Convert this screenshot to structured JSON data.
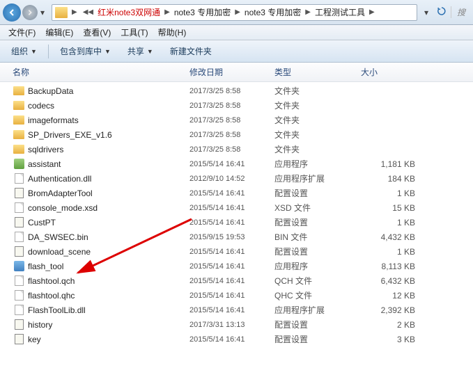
{
  "breadcrumb": {
    "items": [
      "红米note3双网通",
      "note3 专用加密",
      "note3 专用加密",
      "工程测试工具"
    ]
  },
  "search": {
    "placeholder": "搜"
  },
  "menu": {
    "file": "文件(F)",
    "edit": "编辑(E)",
    "view": "查看(V)",
    "tools": "工具(T)",
    "help": "帮助(H)"
  },
  "toolbar": {
    "organize": "组织",
    "include": "包含到库中",
    "share": "共享",
    "newfolder": "新建文件夹"
  },
  "columns": {
    "name": "名称",
    "date": "修改日期",
    "type": "类型",
    "size": "大小"
  },
  "files": [
    {
      "icon": "folder",
      "name": "BackupData",
      "date": "2017/3/25 8:58",
      "type": "文件夹",
      "size": ""
    },
    {
      "icon": "folder",
      "name": "codecs",
      "date": "2017/3/25 8:58",
      "type": "文件夹",
      "size": ""
    },
    {
      "icon": "folder",
      "name": "imageformats",
      "date": "2017/3/25 8:58",
      "type": "文件夹",
      "size": ""
    },
    {
      "icon": "folder",
      "name": "SP_Drivers_EXE_v1.6",
      "date": "2017/3/25 8:58",
      "type": "文件夹",
      "size": ""
    },
    {
      "icon": "folder",
      "name": "sqldrivers",
      "date": "2017/3/25 8:58",
      "type": "文件夹",
      "size": ""
    },
    {
      "icon": "green",
      "name": "assistant",
      "date": "2015/5/14 16:41",
      "type": "应用程序",
      "size": "1,181 KB"
    },
    {
      "icon": "generic",
      "name": "Authentication.dll",
      "date": "2012/9/10 14:52",
      "type": "应用程序扩展",
      "size": "184 KB"
    },
    {
      "icon": "cfg",
      "name": "BromAdapterTool",
      "date": "2015/5/14 16:41",
      "type": "配置设置",
      "size": "1 KB"
    },
    {
      "icon": "generic",
      "name": "console_mode.xsd",
      "date": "2015/5/14 16:41",
      "type": "XSD 文件",
      "size": "15 KB"
    },
    {
      "icon": "cfg",
      "name": "CustPT",
      "date": "2015/5/14 16:41",
      "type": "配置设置",
      "size": "1 KB"
    },
    {
      "icon": "generic",
      "name": "DA_SWSEC.bin",
      "date": "2015/9/15 19:53",
      "type": "BIN 文件",
      "size": "4,432 KB"
    },
    {
      "icon": "cfg",
      "name": "download_scene",
      "date": "2015/5/14 16:41",
      "type": "配置设置",
      "size": "1 KB"
    },
    {
      "icon": "disk",
      "name": "flash_tool",
      "date": "2015/5/14 16:41",
      "type": "应用程序",
      "size": "8,113 KB"
    },
    {
      "icon": "generic",
      "name": "flashtool.qch",
      "date": "2015/5/14 16:41",
      "type": "QCH 文件",
      "size": "6,432 KB"
    },
    {
      "icon": "generic",
      "name": "flashtool.qhc",
      "date": "2015/5/14 16:41",
      "type": "QHC 文件",
      "size": "12 KB"
    },
    {
      "icon": "generic",
      "name": "FlashToolLib.dll",
      "date": "2015/5/14 16:41",
      "type": "应用程序扩展",
      "size": "2,392 KB"
    },
    {
      "icon": "cfg",
      "name": "history",
      "date": "2017/3/31 13:13",
      "type": "配置设置",
      "size": "2 KB"
    },
    {
      "icon": "cfg",
      "name": "key",
      "date": "2015/5/14 16:41",
      "type": "配置设置",
      "size": "3 KB"
    }
  ]
}
